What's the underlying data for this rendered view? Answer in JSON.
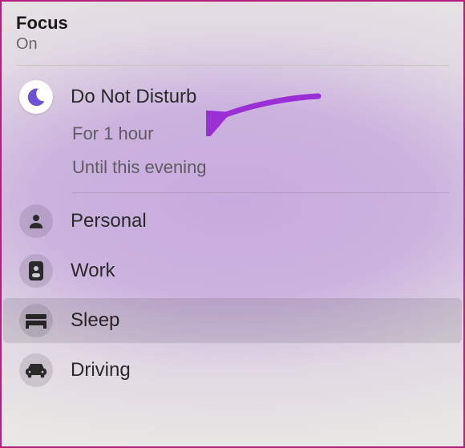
{
  "header": {
    "title": "Focus",
    "status": "On"
  },
  "active": {
    "label": "Do Not Disturb",
    "options": [
      "For 1 hour",
      "Until this evening"
    ]
  },
  "modes": [
    {
      "id": "personal",
      "label": "Personal",
      "icon": "person-icon"
    },
    {
      "id": "work",
      "label": "Work",
      "icon": "badge-icon"
    },
    {
      "id": "sleep",
      "label": "Sleep",
      "icon": "bed-icon"
    },
    {
      "id": "driving",
      "label": "Driving",
      "icon": "car-icon"
    }
  ],
  "colors": {
    "moon": "#6c52d9",
    "glyph": "#2a2a2a",
    "arrow": "#9b2fd6"
  }
}
